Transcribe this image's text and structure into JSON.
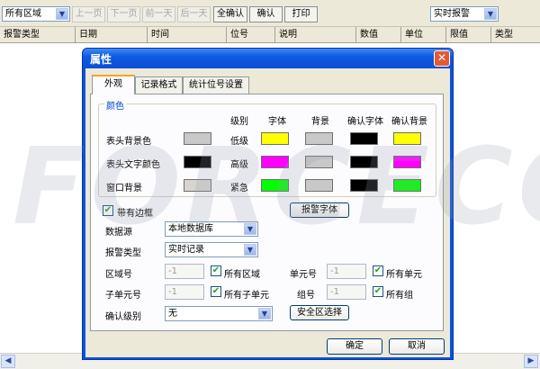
{
  "toolbar": {
    "area_select": "所有区域",
    "buttons": {
      "prev_page": "上一页",
      "next_page": "下一页",
      "prev_day": "前一天",
      "next_day": "后一天",
      "confirm_all": "全确认",
      "confirm": "确认",
      "print": "打印"
    },
    "mode_select": "实时报警"
  },
  "table": {
    "columns": [
      "报警类型",
      "日期",
      "时间",
      "位号",
      "说明",
      "数值",
      "单位",
      "限值",
      "类型"
    ]
  },
  "watermark": "FORCECON",
  "dialog": {
    "title": "属性",
    "tabs": [
      "外观",
      "记录格式",
      "统计位号设置"
    ],
    "color_group": {
      "title": "颜色",
      "col_headers": {
        "level": "级别",
        "font": "字体",
        "background": "背景",
        "confirm_font": "确认字体",
        "confirm_background": "确认背景"
      },
      "left_rows": [
        {
          "label": "表头背景色",
          "color": "#c8c8c8"
        },
        {
          "label": "表头文字颜色",
          "color": "#000000"
        },
        {
          "label": "窗口背景",
          "color": "#d8d5d0"
        }
      ],
      "level_rows": [
        {
          "level": "低级",
          "font": "#ffff00",
          "background": "#c8c8c8",
          "confirm_font": "#000000",
          "confirm_background": "#ffff00"
        },
        {
          "level": "高级",
          "font": "#ff00ff",
          "background": "#c8c8c8",
          "confirm_font": "#000000",
          "confirm_background": "#ff00ff"
        },
        {
          "level": "紧急",
          "font": "#00ff00",
          "background": "#c8c8c8",
          "confirm_font": "#000000",
          "confirm_background": "#00ff00"
        }
      ]
    },
    "with_border_label": "带有边框",
    "with_border_checked": true,
    "alarm_font_button": "报警字体",
    "data_source_label": "数据源",
    "data_source_value": "本地数据库",
    "alarm_type_label": "报警类型",
    "alarm_type_value": "实时记录",
    "area_no_label": "区域号",
    "area_no_value": "-1",
    "all_areas_label": "所有区域",
    "unit_no_label": "单元号",
    "unit_no_value": "-1",
    "all_units_label": "所有单元",
    "subunit_no_label": "子单元号",
    "subunit_no_value": "-1",
    "all_subunits_label": "所有子单元",
    "group_no_label": "组号",
    "group_no_value": "-1",
    "all_groups_label": "所有组",
    "confirm_level_label": "确认级别",
    "confirm_level_value": "无",
    "safety_zone_button": "安全区选择",
    "ok_button": "确定",
    "cancel_button": "取消"
  }
}
